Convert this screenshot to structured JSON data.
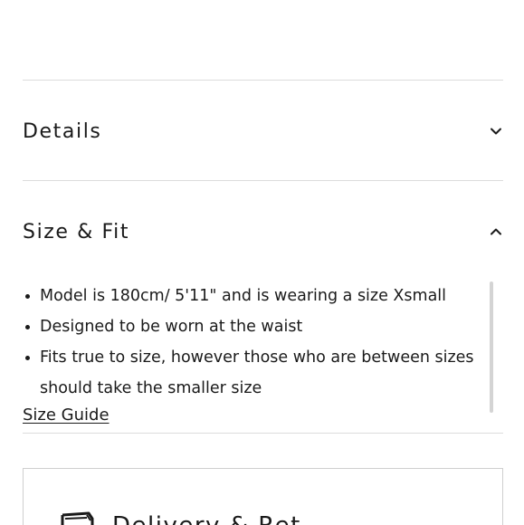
{
  "accordion": {
    "details": {
      "title": "Details",
      "state": "collapsed",
      "icon": "chevron-down-icon"
    },
    "size_fit": {
      "title": "Size & Fit",
      "state": "expanded",
      "icon": "chevron-up-icon",
      "items": [
        "Model is 180cm/ 5'11\" and is wearing a size Xsmall",
        "Designed to be worn at the waist",
        "Fits true to size, however those who are between sizes should take the smaller size"
      ],
      "size_guide_label": "Size Guide"
    }
  },
  "delivery": {
    "title": "Delivery & Ret",
    "icon": "delivery-box-icon"
  }
}
